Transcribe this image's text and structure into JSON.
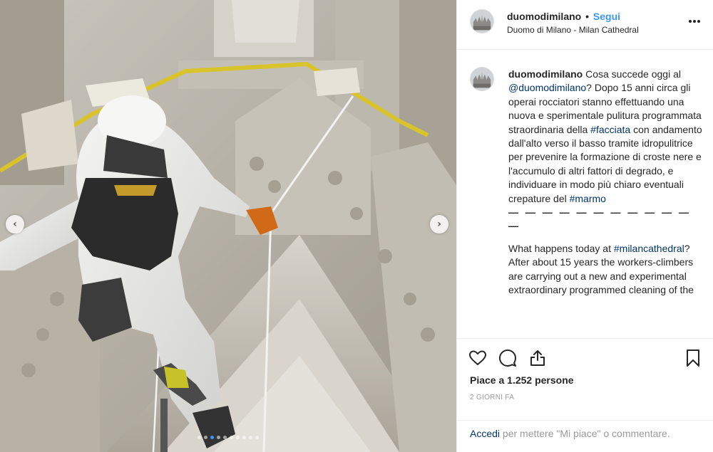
{
  "header": {
    "username": "duomodimilano",
    "separator": "•",
    "follow_label": "Segui",
    "location": "Duomo di Milano - Milan Cathedral",
    "more_icon": "more-horizontal-icon"
  },
  "caption": {
    "username": "duomodimilano",
    "p1_t1": "Cosa succede oggi al ",
    "p1_mention": "@duomodimilano",
    "p1_t2": "? Dopo 15 anni circa gli operai rocciatori stanno effettuando una nuova e sperimentale pulitura programmata straordinaria della ",
    "p1_hashtag1": "#facciata",
    "p1_t3": " con andamento dall'alto verso il basso tramite idropulitrice per prevenire la formazione di croste nere e l'accumulo di altri fattori di degrado, e individuare in modo più chiaro eventuali crepature del ",
    "p1_hashtag2": "#marmo",
    "separator_line": "— — — — — — — — — — — —",
    "p2_t1": "What happens today at ",
    "p2_hashtag1": "#milancathedral",
    "p2_t2": "? After about 15 years the workers-climbers are carrying out a new and experimental extraordinary programmed cleaning of the"
  },
  "actions": {
    "like_icon": "heart-icon",
    "comment_icon": "comment-icon",
    "share_icon": "share-icon",
    "save_icon": "bookmark-icon",
    "likes_text": "Piace a 1.252 persone",
    "time_text": "2 GIORNI FA"
  },
  "footer": {
    "login_link": "Accedi",
    "login_text": " per mettere \"Mi piace\" o commentare."
  },
  "carousel": {
    "prev_icon": "chevron-left-icon",
    "next_icon": "chevron-right-icon",
    "prev_glyph": "‹",
    "next_glyph": "›",
    "slide_count": 10,
    "active_index": 2
  },
  "colors": {
    "accent": "#3897f0",
    "link": "#003569",
    "muted": "#999999",
    "text": "#262626"
  }
}
